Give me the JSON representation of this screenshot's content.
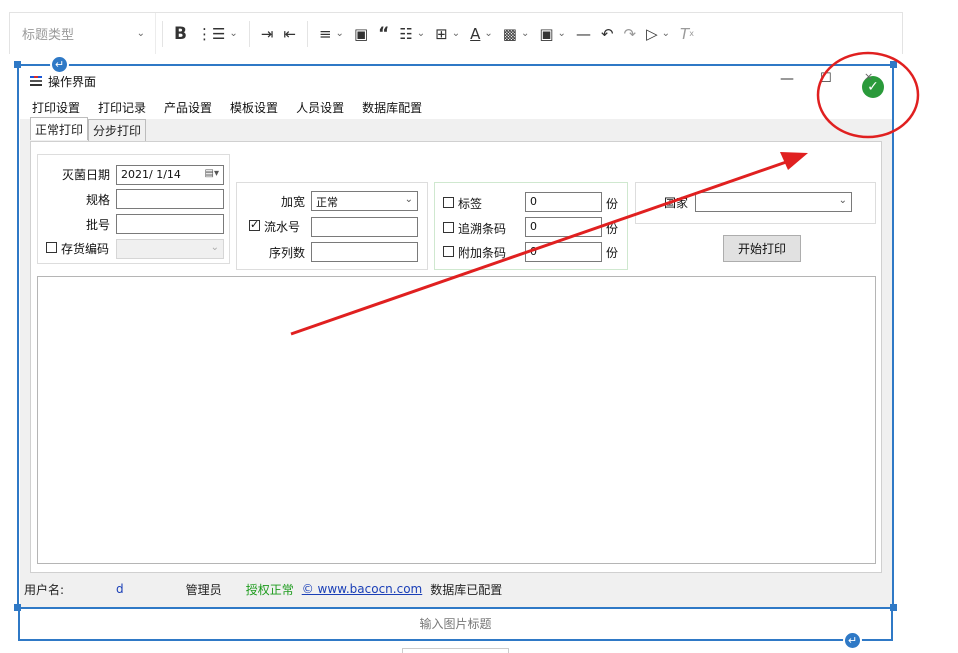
{
  "toolbar": {
    "heading_select": "标题类型",
    "icons": [
      "bold-icon",
      "list-icon",
      "indent-icon",
      "outdent-icon",
      "align-icon",
      "image-icon",
      "quote-icon",
      "code-icon",
      "table-icon",
      "font-color-icon",
      "bg-color-icon",
      "image-options-icon",
      "divider-icon",
      "undo-icon",
      "redo-icon",
      "video-icon",
      "clear-format-icon"
    ]
  },
  "window": {
    "title": "操作界面",
    "menu": [
      "打印设置",
      "打印记录",
      "产品设置",
      "模板设置",
      "人员设置",
      "数据库配置"
    ],
    "tabs": [
      "正常打印",
      "分步打印"
    ],
    "group1": {
      "date_label": "灭菌日期",
      "date_value": "2021/ 1/14",
      "spec_label": "规格",
      "batch_label": "批号",
      "inventory_label": "存货编码"
    },
    "group2": {
      "width_label": "加宽",
      "width_value": "正常",
      "serial_label": "流水号",
      "sequence_label": "序列数"
    },
    "group3": {
      "label_label": "标签",
      "label_value": "0",
      "trace_label": "追溯条码",
      "trace_value": "0",
      "extra_label": "附加条码",
      "extra_value": "0",
      "unit": "份"
    },
    "group4": {
      "country_label": "国家",
      "start_button": "开始打印"
    },
    "status": {
      "user_label": "用户名:",
      "user_value": "d",
      "role": "管理员",
      "license": "授权正常",
      "website": "© www.bacocn.com",
      "db_status": "数据库已配置"
    }
  },
  "caption_placeholder": "输入图片标题",
  "colors": {
    "frame_blue": "#2f79c6",
    "annotation_red": "#e02020",
    "ok_green": "#1d9b1d"
  }
}
